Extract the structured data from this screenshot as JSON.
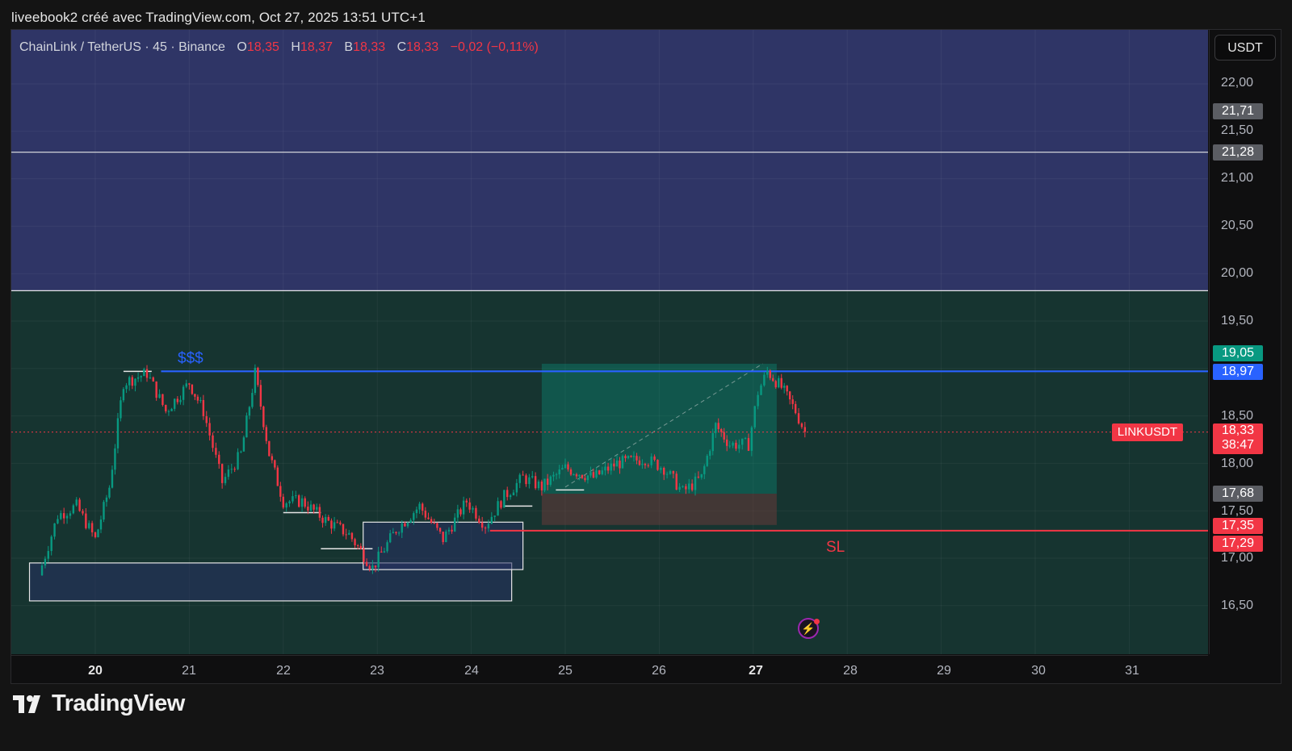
{
  "snapshot_header": "liveebook2 créé avec TradingView.com, Oct 27, 2025 13:51 UTC+1",
  "legend": {
    "symbol": "ChainLink / TetherUS · 45 · Binance",
    "open_label": "O",
    "open": "18,35",
    "high_label": "H",
    "high": "18,37",
    "low_label": "B",
    "low": "18,33",
    "close_label": "C",
    "close": "18,33",
    "change": "−0,02 (−0,11%)"
  },
  "currency_button": "USDT",
  "price_axis": {
    "ticks": [
      "22,00",
      "21,50",
      "21,00",
      "20,50",
      "20,00",
      "19,50",
      "18,50",
      "18,00",
      "17,50",
      "17,00",
      "16,50"
    ],
    "tags": {
      "t2171": "21,71",
      "t2128": "21,28",
      "t1905": "19,05",
      "t1897": "18,97",
      "last_price": "18,33",
      "countdown": "38:47",
      "t1768": "17,68",
      "t1735": "17,35",
      "t1729": "17,29"
    }
  },
  "symbol_tag": "LINKUSDT",
  "time_axis": [
    "20",
    "21",
    "22",
    "23",
    "24",
    "25",
    "26",
    "27",
    "28",
    "29",
    "30",
    "31"
  ],
  "annotations": {
    "liquidity": "$$$",
    "stop_loss": "SL"
  },
  "brand": "TradingView",
  "colors": {
    "up": "#089981",
    "down": "#f23645",
    "accent": "#2962ff",
    "zone_upper": "#2f3566",
    "zone_lower": "#163430"
  },
  "chart_data": {
    "type": "candlestick",
    "symbol": "ChainLink / TetherUS",
    "x": [
      "20",
      "21",
      "22",
      "23",
      "24",
      "25",
      "26",
      "27",
      "28",
      "29",
      "30",
      "31"
    ],
    "ylim": [
      16.3,
      22.6
    ],
    "levels": {
      "supply_zone": [
        19.82,
        22.6
      ],
      "line_upper": 21.28,
      "liquidity_line": 18.97,
      "last_price": 18.33,
      "stop_loss": 17.29
    },
    "position": {
      "entry": 17.68,
      "target": 19.05,
      "stop": 17.35
    },
    "close_path": [
      [
        "19.4",
        16.82
      ],
      [
        "19.6",
        17.45
      ],
      [
        "19.8",
        17.55
      ],
      [
        "20.0",
        17.2
      ],
      [
        "20.15",
        17.75
      ],
      [
        "20.3",
        18.85
      ],
      [
        "20.55",
        18.95
      ],
      [
        "20.75",
        18.55
      ],
      [
        "21.0",
        18.85
      ],
      [
        "21.15",
        18.55
      ],
      [
        "21.35",
        17.8
      ],
      [
        "21.55",
        18.1
      ],
      [
        "21.7",
        18.95
      ],
      [
        "21.85",
        18.1
      ],
      [
        "22.0",
        17.6
      ],
      [
        "22.2",
        17.6
      ],
      [
        "22.45",
        17.4
      ],
      [
        "22.7",
        17.25
      ],
      [
        "22.95",
        16.9
      ],
      [
        "23.2",
        17.3
      ],
      [
        "23.45",
        17.55
      ],
      [
        "23.7",
        17.2
      ],
      [
        "23.95",
        17.6
      ],
      [
        "24.15",
        17.35
      ],
      [
        "24.35",
        17.65
      ],
      [
        "24.55",
        17.85
      ],
      [
        "24.75",
        17.75
      ],
      [
        "25.0",
        17.95
      ],
      [
        "25.3",
        17.85
      ],
      [
        "25.55",
        18.0
      ],
      [
        "25.85",
        18.05
      ],
      [
        "26.05",
        17.95
      ],
      [
        "26.25",
        17.7
      ],
      [
        "26.45",
        17.85
      ],
      [
        "26.6",
        18.4
      ],
      [
        "26.75",
        18.2
      ],
      [
        "26.95",
        18.2
      ],
      [
        "27.05",
        18.75
      ],
      [
        "27.15",
        18.97
      ],
      [
        "27.3",
        18.8
      ],
      [
        "27.45",
        18.55
      ],
      [
        "27.55",
        18.33
      ]
    ]
  }
}
